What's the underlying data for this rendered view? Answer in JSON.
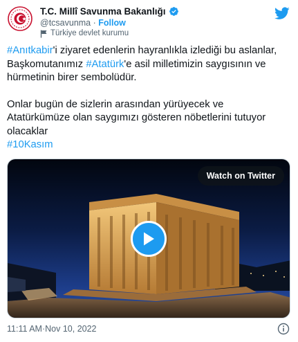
{
  "account": {
    "display_name": "T.C. Millî Savunma Bakanlığı",
    "handle": "@tcsavunma",
    "separator": " · ",
    "follow_label": "Follow",
    "label": "Türkiye devlet kurumu",
    "verified": true
  },
  "tweet": {
    "p1": {
      "tag1": "#Anıtkabir",
      "text1": "'i ziyaret edenlerin hayranlıkla izlediği bu aslanlar, Başkomutanımız ",
      "tag2": "#Atatürk",
      "text2": "'e asil milletimizin saygısının ve hürmetinin birer sembolüdür."
    },
    "p2": {
      "text": "Onlar bugün de sizlerin arasından yürüyecek ve Atatürkümüze olan saygımızı gösteren nöbetlerini tutuyor olacaklar",
      "tag": "#10Kasım"
    }
  },
  "media": {
    "watch_label": "Watch on Twitter"
  },
  "meta": {
    "time": "11:11 AM",
    "separator": " · ",
    "date": "Nov 10, 2022"
  },
  "colors": {
    "accent": "#1d9bf0",
    "secondary_text": "#536471",
    "avatar_red": "#c8102e"
  },
  "icons": [
    "verified-badge-icon",
    "government-label-icon",
    "twitter-bird-icon",
    "play-icon",
    "info-icon"
  ]
}
